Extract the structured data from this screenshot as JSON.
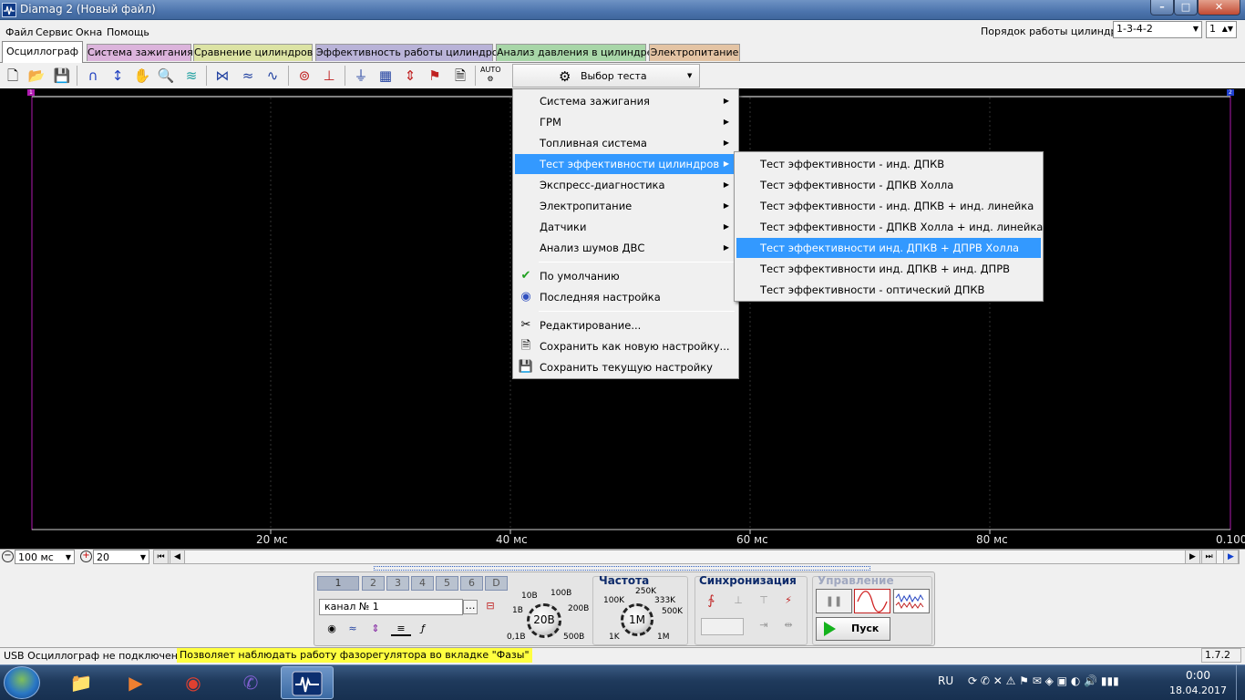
{
  "window": {
    "title": "Diamag 2 (Новый файл)"
  },
  "menubar": {
    "items": [
      "Файл",
      "Сервис",
      "Окна",
      "Помощь"
    ]
  },
  "cylinder_order": {
    "label": "Порядок работы цилиндров",
    "value": "1-3-4-2",
    "number": "1"
  },
  "tabs": [
    "Осциллограф",
    "Система зажигания",
    "Сравнение цилиндров",
    "Эффективность работы цилиндров",
    "Анализ давления в цилиндре",
    "Электропитание"
  ],
  "toolbar": {
    "test_select_label": "Выбор теста",
    "auto_label": "AUTO"
  },
  "scope": {
    "time_ticks": [
      "20 мс",
      "40 мс",
      "60 мс",
      "80 мс",
      "0.100"
    ],
    "marker_left": "1",
    "marker_right": "2",
    "time_scale": "100 мс",
    "amp_scale": "20"
  },
  "test_menu": {
    "items": [
      "Система зажигания",
      "ГРМ",
      "Топливная система",
      "Тест эффективности цилиндров",
      "Экспресс-диагностика",
      "Электропитание",
      "Датчики",
      "Анализ шумов ДВС"
    ],
    "settings": [
      "По умолчанию",
      "Последняя настройка"
    ],
    "actions": [
      "Редактирование...",
      "Сохранить как новую настройку...",
      "Сохранить текущую настройку"
    ]
  },
  "sub_menu": {
    "items": [
      "Тест эффективности - инд. ДПКВ",
      "Тест эффективности - ДПКВ Холла",
      "Тест эффективности - инд. ДПКВ + инд. линейка",
      "Тест эффективности - ДПКВ Холла + инд. линейка",
      "Тест эффективности инд. ДПКВ + ДПРВ Холла",
      "Тест эффективности инд. ДПКВ + инд. ДПРВ",
      "Тест эффективности - оптический ДПКВ"
    ]
  },
  "panel": {
    "channels": [
      "1",
      "2",
      "3",
      "4",
      "5",
      "6",
      "D"
    ],
    "channel_name": "канал № 1",
    "volt_knob": "20В",
    "volt_labels": [
      "10В",
      "100В",
      "1В",
      "200В",
      "0,1В",
      "500В"
    ],
    "freq_title": "Частота",
    "freq_knob": "1M",
    "freq_labels": [
      "250K",
      "100K",
      "333K",
      "500K",
      "1K",
      "1M"
    ],
    "sync_title": "Синхронизация",
    "control_title": "Управление",
    "start_label": "Пуск"
  },
  "statusbar": {
    "usb": "USB Осциллограф не подключен",
    "hint": "Позволяет наблюдать работу фазорегулятора во вкладке \"Фазы\"",
    "version": "1.7.2"
  },
  "taskbar": {
    "lang": "RU",
    "time": "0:00",
    "date": "18.04.2017"
  },
  "colors": {
    "highlight": "#3399ff",
    "scope_bg": "#000000",
    "hint_bg": "#ffff40",
    "border_magenta": "#b01ab0"
  }
}
